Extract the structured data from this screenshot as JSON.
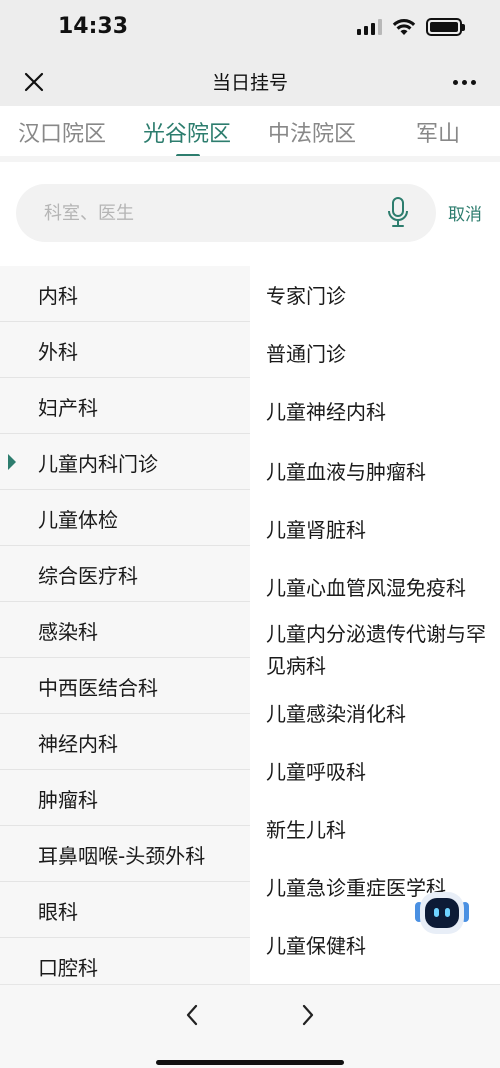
{
  "status_bar": {
    "time": "14:33"
  },
  "nav": {
    "title": "当日挂号"
  },
  "tabs": [
    {
      "label": "汉口院区",
      "active": false
    },
    {
      "label": "光谷院区",
      "active": true
    },
    {
      "label": "中法院区",
      "active": false
    },
    {
      "label": "军山",
      "active": false
    }
  ],
  "search": {
    "placeholder": "科室、医生",
    "value": "",
    "cancel_label": "取消"
  },
  "left_list": {
    "selected_index": 3,
    "items": [
      "内科",
      "外科",
      "妇产科",
      "儿童内科门诊",
      "儿童体检",
      "综合医疗科",
      "感染科",
      "中西医结合科",
      "神经内科",
      "肿瘤科",
      "耳鼻咽喉-头颈外科",
      "眼科",
      "口腔科"
    ]
  },
  "right_list": {
    "items": [
      "专家门诊",
      "普通门诊",
      "儿童神经内科",
      "儿童血液与肿瘤科",
      "儿童肾脏科",
      "儿童心血管风湿免疫科",
      "儿童内分泌遗传代谢与罕见病科",
      "儿童感染消化科",
      "儿童呼吸科",
      "新生儿科",
      "儿童急诊重症医学科",
      "儿童保健科"
    ]
  },
  "colors": {
    "accent": "#2d7d6e",
    "text": "#1a1a1a",
    "muted": "#888888",
    "panel": "#f7f7f7"
  },
  "icons": {
    "close": "close-icon",
    "more": "more-dots-icon",
    "mic": "microphone-icon",
    "back": "chevron-left-icon",
    "forward": "chevron-right-icon",
    "assistant": "robot-assistant-icon"
  }
}
